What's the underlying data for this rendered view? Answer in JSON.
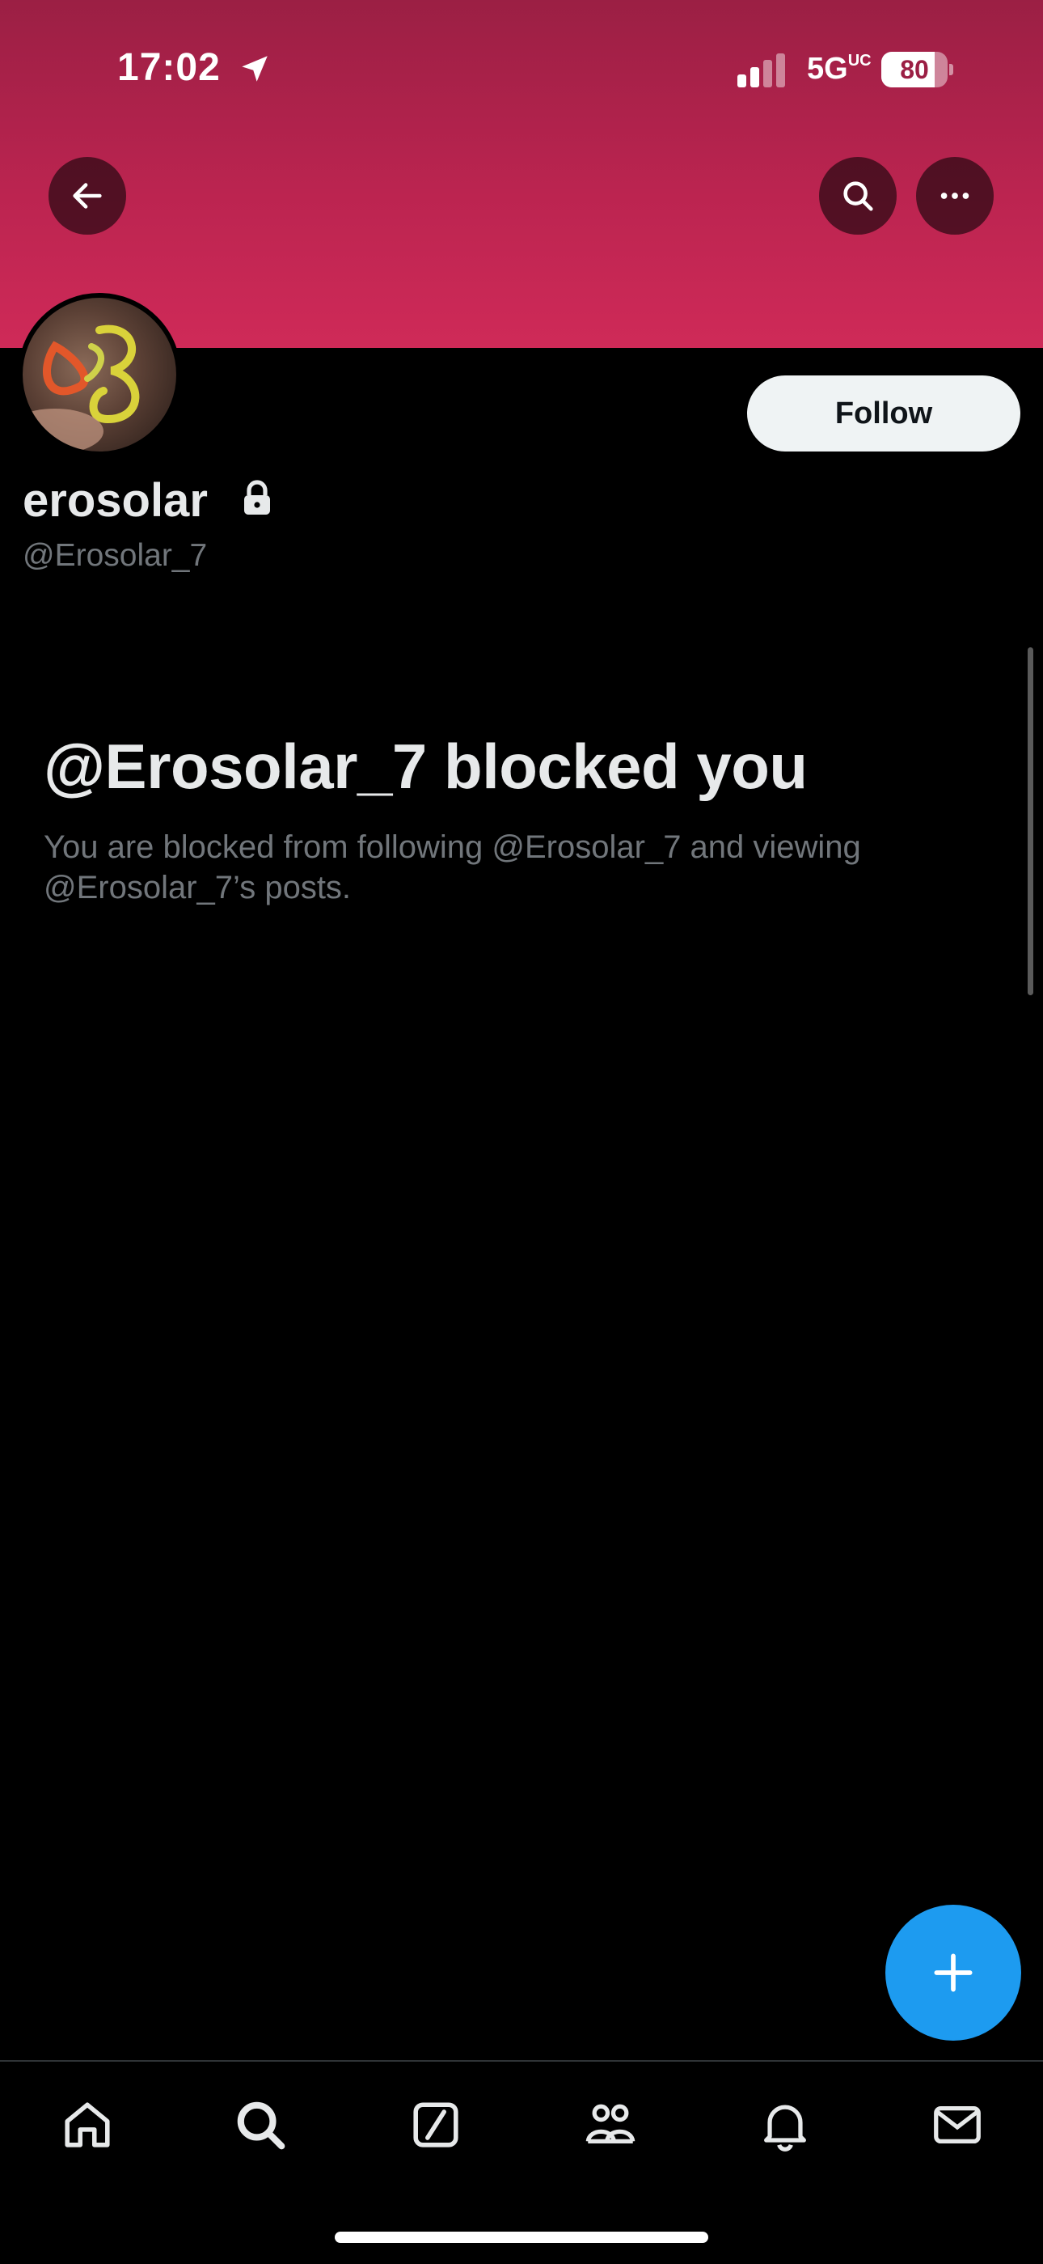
{
  "status_bar": {
    "time": "17:02",
    "network": "5G",
    "network_badge": "UC",
    "battery_level": "80",
    "battery_fraction": 0.8
  },
  "header": {
    "banner_color": "#c2244f"
  },
  "profile": {
    "display_name": "erosolar",
    "handle": "@Erosolar_7",
    "follow_label": "Follow",
    "protected": true
  },
  "blocked": {
    "title": "@Erosolar_7 blocked you",
    "description": "You are blocked from following @Erosolar_7 and viewing @Erosolar_7’s posts."
  },
  "tabbar": {
    "items": [
      "home-icon",
      "search-icon",
      "grok-icon",
      "communities-icon",
      "notifications-icon",
      "messages-icon"
    ]
  },
  "fab_icon": "plus-icon",
  "accent_color": "#1d9bf0"
}
